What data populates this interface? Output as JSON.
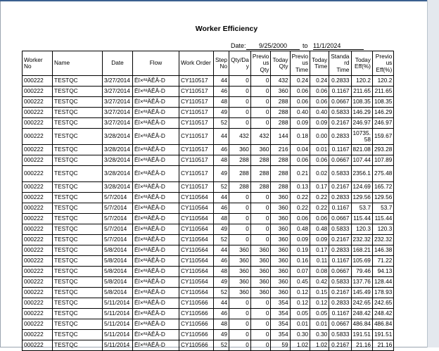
{
  "report": {
    "title": "Worker Efficiency",
    "date_label": "Date:",
    "date_from": "9/25/2000",
    "to_label": "to",
    "date_to": "11/1/2024"
  },
  "columns": [
    "Worker No",
    "Name",
    "Date",
    "Flow",
    "Work Order",
    "Step No",
    "Qty/Day",
    "Previous Qty",
    "Today Qty",
    "Previous Time",
    "Today Time",
    "Standard Time",
    "Today Eff(%)",
    "Previous Eff(%)"
  ],
  "column_display": [
    "Worker No",
    "Name",
    "Date",
    "Flow",
    "Work Order",
    "Step\nNo",
    "Qty/Da\ny",
    "Previo\nus Qty",
    "Today\nQty",
    "Previo\nus\nTime",
    "Today\nTime",
    "Standa\nrd\nTime",
    "Today\nEff(%)",
    "Previo\nus\nEff(%)"
  ],
  "rows": [
    [
      "000222",
      "TESTQC",
      "3/27/2014",
      "Ëî×ª³ÄÊÂ-D",
      "CY110517",
      "44",
      "0",
      "0",
      "432",
      "0.24",
      "0.24",
      "0.2833",
      "120.2",
      "120.2"
    ],
    [
      "000222",
      "TESTQC",
      "3/27/2014",
      "Ëî×ª³ÄÊÂ-D",
      "CY110517",
      "46",
      "0",
      "0",
      "360",
      "0.06",
      "0.06",
      "0.1167",
      "211.65",
      "211.65"
    ],
    [
      "000222",
      "TESTQC",
      "3/27/2014",
      "Ëî×ª³ÄÊÂ-D",
      "CY110517",
      "48",
      "0",
      "0",
      "288",
      "0.06",
      "0.06",
      "0.0667",
      "108.35",
      "108.35"
    ],
    [
      "000222",
      "TESTQC",
      "3/27/2014",
      "Ëî×ª³ÄÊÂ-D",
      "CY110517",
      "49",
      "0",
      "0",
      "288",
      "0.40",
      "0.40",
      "0.5833",
      "146.29",
      "146.29"
    ],
    [
      "000222",
      "TESTQC",
      "3/27/2014",
      "Ëî×ª³ÄÊÂ-D",
      "CY110517",
      "52",
      "0",
      "0",
      "288",
      "0.09",
      "0.09",
      "0.2167",
      "246.97",
      "246.97"
    ],
    [
      "000222",
      "TESTQC",
      "3/28/2014",
      "Ëî×ª³ÄÊÂ-D",
      "CY110517",
      "44",
      "432",
      "432",
      "144",
      "0.18",
      "0.00",
      "0.2833",
      "10735.58",
      "159.67"
    ],
    [
      "000222",
      "TESTQC",
      "3/28/2014",
      "Ëî×ª³ÄÊÂ-D",
      "CY110517",
      "46",
      "360",
      "360",
      "216",
      "0.04",
      "0.01",
      "0.1167",
      "821.08",
      "293.28"
    ],
    [
      "000222",
      "TESTQC",
      "3/28/2014",
      "Ëî×ª³ÄÊÂ-D",
      "CY110517",
      "48",
      "288",
      "288",
      "288",
      "0.06",
      "0.06",
      "0.0667",
      "107.44",
      "107.89"
    ],
    [
      "000222",
      "TESTQC",
      "3/28/2014",
      "Ëî×ª³ÄÊÂ-D",
      "CY110517",
      "49",
      "288",
      "288",
      "288",
      "0.21",
      "0.02",
      "0.5833",
      "2356.1",
      "275.48"
    ],
    [
      "000222",
      "TESTQC",
      "3/28/2014",
      "Ëî×ª³ÄÊÂ-D",
      "CY110517",
      "52",
      "288",
      "288",
      "288",
      "0.13",
      "0.17",
      "0.2167",
      "124.69",
      "165.72"
    ],
    [
      "000222",
      "TESTQC",
      "5/7/2014",
      "Ëî×ª³ÄÊÂ-D",
      "CY110564",
      "44",
      "0",
      "0",
      "360",
      "0.22",
      "0.22",
      "0.2833",
      "129.56",
      "129.56"
    ],
    [
      "000222",
      "TESTQC",
      "5/7/2014",
      "Ëî×ª³ÄÊÂ-D",
      "CY110564",
      "46",
      "0",
      "0",
      "360",
      "0.22",
      "0.22",
      "0.1167",
      "53.7",
      "53.7"
    ],
    [
      "000222",
      "TESTQC",
      "5/7/2014",
      "Ëî×ª³ÄÊÂ-D",
      "CY110564",
      "48",
      "0",
      "0",
      "360",
      "0.06",
      "0.06",
      "0.0667",
      "115.44",
      "115.44"
    ],
    [
      "000222",
      "TESTQC",
      "5/7/2014",
      "Ëî×ª³ÄÊÂ-D",
      "CY110564",
      "49",
      "0",
      "0",
      "360",
      "0.48",
      "0.48",
      "0.5833",
      "120.3",
      "120.3"
    ],
    [
      "000222",
      "TESTQC",
      "5/7/2014",
      "Ëî×ª³ÄÊÂ-D",
      "CY110564",
      "52",
      "0",
      "0",
      "360",
      "0.09",
      "0.09",
      "0.2167",
      "232.32",
      "232.32"
    ],
    [
      "000222",
      "TESTQC",
      "5/8/2014",
      "Ëî×ª³ÄÊÂ-D",
      "CY110564",
      "44",
      "360",
      "360",
      "360",
      "0.19",
      "0.17",
      "0.2833",
      "168.21",
      "146.38"
    ],
    [
      "000222",
      "TESTQC",
      "5/8/2014",
      "Ëî×ª³ÄÊÂ-D",
      "CY110564",
      "46",
      "360",
      "360",
      "360",
      "0.16",
      "0.11",
      "0.1167",
      "105.69",
      "71.22"
    ],
    [
      "000222",
      "TESTQC",
      "5/8/2014",
      "Ëî×ª³ÄÊÂ-D",
      "CY110564",
      "48",
      "360",
      "360",
      "360",
      "0.07",
      "0.08",
      "0.0667",
      "79.46",
      "94.13"
    ],
    [
      "000222",
      "TESTQC",
      "5/8/2014",
      "Ëî×ª³ÄÊÂ-D",
      "CY110564",
      "49",
      "360",
      "360",
      "360",
      "0.45",
      "0.42",
      "0.5833",
      "137.76",
      "128.44"
    ],
    [
      "000222",
      "TESTQC",
      "5/8/2014",
      "Ëî×ª³ÄÊÂ-D",
      "CY110564",
      "52",
      "360",
      "360",
      "360",
      "0.12",
      "0.15",
      "0.2167",
      "145.49",
      "178.93"
    ],
    [
      "000222",
      "TESTQC",
      "5/11/2014",
      "Ëî×ª³ÄÊÂ-D",
      "CY110566",
      "44",
      "0",
      "0",
      "354",
      "0.12",
      "0.12",
      "0.2833",
      "242.65",
      "242.65"
    ],
    [
      "000222",
      "TESTQC",
      "5/11/2014",
      "Ëî×ª³ÄÊÂ-D",
      "CY110566",
      "46",
      "0",
      "0",
      "354",
      "0.05",
      "0.05",
      "0.1167",
      "248.42",
      "248.42"
    ],
    [
      "000222",
      "TESTQC",
      "5/11/2014",
      "Ëî×ª³ÄÊÂ-D",
      "CY110566",
      "48",
      "0",
      "0",
      "354",
      "0.01",
      "0.01",
      "0.0667",
      "486.84",
      "486.84"
    ],
    [
      "000222",
      "TESTQC",
      "5/11/2014",
      "Ëî×ª³ÄÊÂ-D",
      "CY110566",
      "49",
      "0",
      "0",
      "354",
      "0.30",
      "0.30",
      "0.5833",
      "191.51",
      "191.51"
    ],
    [
      "000222",
      "TESTQC",
      "5/11/2014",
      "Ëî×ª³ÄÊÂ-D",
      "CY110566",
      "52",
      "0",
      "0",
      "59",
      "1.02",
      "1.02",
      "0.2167",
      "21.16",
      "21.16"
    ]
  ]
}
